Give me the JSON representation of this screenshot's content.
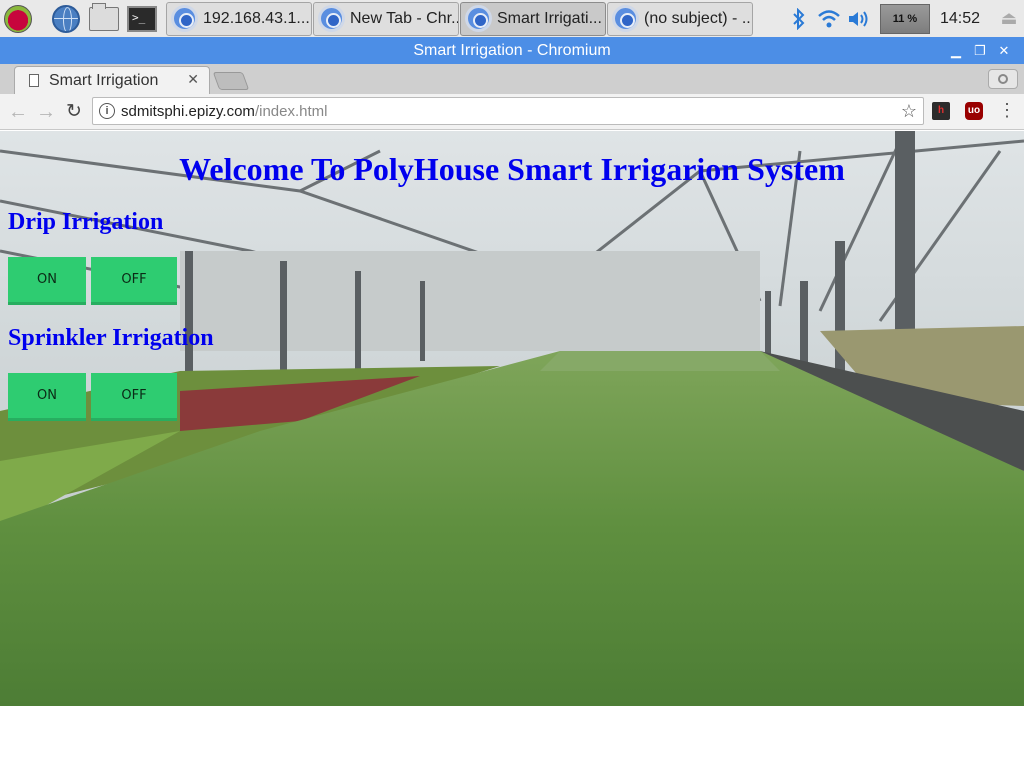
{
  "taskbar": {
    "tasks": [
      {
        "label": "192.168.43.1..."
      },
      {
        "label": "New Tab - Chr..."
      },
      {
        "label": "Smart Irrigati..."
      },
      {
        "label": "(no subject) - ..."
      }
    ],
    "cpu_usage": "11 %",
    "clock": "14:52"
  },
  "window": {
    "title": "Smart Irrigation - Chromium"
  },
  "browser": {
    "tab_title": "Smart Irrigation",
    "url_host": "sdmitsphi.epizy.com",
    "url_path": "/index.html"
  },
  "page": {
    "title": "Welcome To PolyHouse Smart Irrigarion System",
    "sections": [
      {
        "heading": "Drip Irrigation",
        "on_label": "ON",
        "off_label": "OFF"
      },
      {
        "heading": "Sprinkler Irrigation",
        "on_label": "ON",
        "off_label": "OFF"
      }
    ],
    "button_color": "#2ecc71",
    "heading_color": "#0000ee"
  }
}
